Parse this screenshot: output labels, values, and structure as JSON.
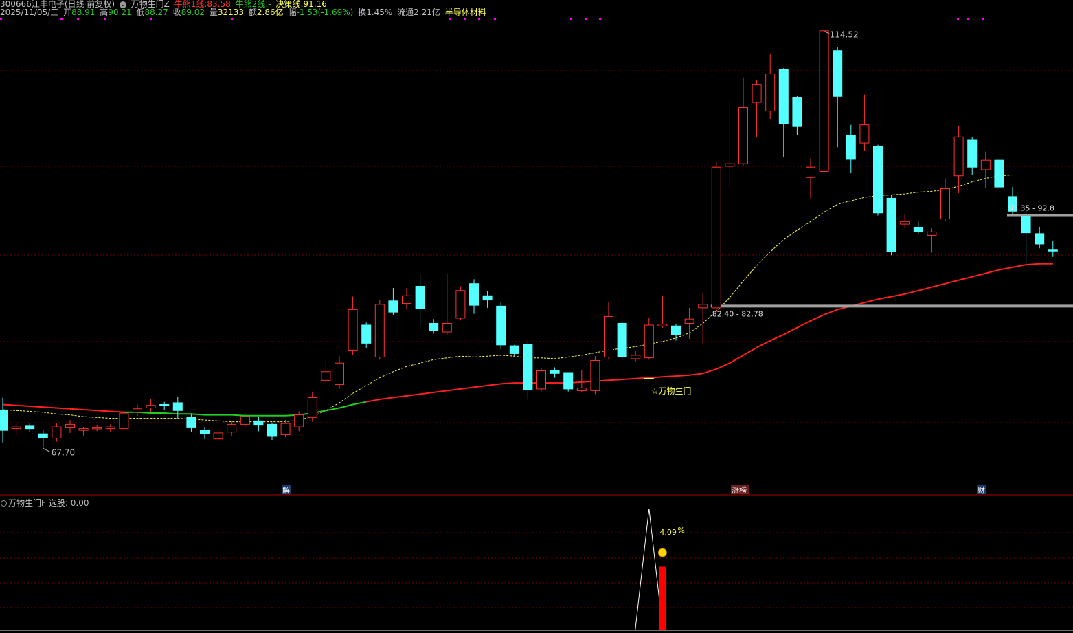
{
  "header": {
    "line1": {
      "code": "300666",
      "name": "江丰电子",
      "mode": "(日线 前复权)",
      "indicator_icon": "chevron-circle-icon",
      "indicator": "万物生门Z",
      "l1_label": "牛熊1线:",
      "l1_value": "83.58",
      "l2_label": "牛熊2线:",
      "l2_value": "-",
      "decision_label": "决策线:",
      "decision_value": "91.16"
    },
    "line2": {
      "date": "2025/11/05/三",
      "open_label": "开",
      "open": "88.91",
      "high_label": "高",
      "high": "90.21",
      "low_label": "低",
      "low": "88.27",
      "close_label": "收",
      "close": "89.02",
      "vol_label": "量",
      "vol": "32133",
      "amount_label": "额",
      "amount": "2.86亿",
      "chg_label": "幅",
      "chg": "-1.53(-1.69%)",
      "turnover": "换1.45%",
      "float_shares": "流通2.21亿",
      "sector": "半导体材料"
    }
  },
  "annotations": {
    "high_label": "114.52",
    "low_label": "67.70",
    "signal_label": "☆万物生门",
    "band_upper": "93.35 - 92.8",
    "band_lower": "82.40 - 82.78",
    "event_jie": "解",
    "event_zhangbang": "涨榜",
    "event_cai": "财"
  },
  "indicator": {
    "title": "万物生门F",
    "stat": "选股: 0.00",
    "peak_label": "4.09",
    "pct_mark": "%",
    "smile_icon": "smiley-face-icon"
  },
  "colors": {
    "up": "#ff3232",
    "down": "#54ffff",
    "ma_slow": "#ff2020",
    "ma_slow_bull": "#22cc22",
    "ma_fast": "#ffff55",
    "band": "#a0a0a0",
    "grid": "#7a0000",
    "magenta": "#ff00ff"
  },
  "chart_data": {
    "type": "candlestick",
    "price_range": [
      62.0,
      116.0
    ],
    "indicator_range": [
      0,
      100
    ],
    "candles": [
      [
        70.5,
        68.2,
        72.0,
        66.8
      ],
      [
        68.4,
        68.6,
        69.1,
        67.6
      ],
      [
        68.7,
        68.4,
        69.0,
        68.0
      ],
      [
        67.8,
        67.3,
        68.2,
        66.2
      ],
      [
        67.3,
        68.6,
        69.0,
        66.9
      ],
      [
        68.5,
        68.9,
        69.4,
        67.9
      ],
      [
        68.2,
        68.4,
        68.6,
        67.6
      ],
      [
        68.4,
        68.5,
        68.8,
        68.1
      ],
      [
        68.4,
        68.6,
        68.9,
        68.0
      ],
      [
        68.4,
        70.2,
        70.6,
        68.2
      ],
      [
        70.3,
        70.7,
        71.2,
        69.9
      ],
      [
        70.8,
        71.1,
        71.8,
        70.3
      ],
      [
        71.2,
        71.1,
        71.5,
        70.6
      ],
      [
        71.4,
        70.5,
        72.1,
        69.6
      ],
      [
        69.7,
        68.5,
        70.1,
        68.0
      ],
      [
        68.2,
        67.8,
        68.6,
        67.2
      ],
      [
        67.2,
        67.9,
        68.3,
        66.9
      ],
      [
        68.0,
        68.9,
        69.3,
        67.6
      ],
      [
        68.9,
        69.8,
        70.2,
        68.5
      ],
      [
        69.3,
        68.8,
        69.8,
        68.1
      ],
      [
        68.9,
        67.5,
        69.0,
        67.1
      ],
      [
        67.7,
        69.0,
        69.4,
        67.4
      ],
      [
        68.6,
        70.0,
        70.4,
        68.1
      ],
      [
        69.7,
        72.0,
        72.6,
        69.2
      ],
      [
        74.0,
        75.0,
        76.3,
        73.5
      ],
      [
        73.5,
        76.0,
        76.8,
        73.0
      ],
      [
        77.5,
        82.2,
        83.7,
        76.9
      ],
      [
        80.4,
        78.3,
        80.7,
        77.7
      ],
      [
        76.7,
        82.8,
        83.3,
        76.4
      ],
      [
        83.2,
        81.9,
        84.7,
        81.6
      ],
      [
        82.9,
        83.8,
        84.7,
        82.2
      ],
      [
        84.9,
        82.3,
        86.3,
        80.2
      ],
      [
        80.6,
        79.8,
        81.1,
        79.4
      ],
      [
        79.6,
        80.6,
        86.3,
        79.3
      ],
      [
        81.2,
        84.4,
        84.9,
        81.0
      ],
      [
        85.2,
        82.7,
        85.7,
        81.7
      ],
      [
        83.8,
        83.3,
        84.3,
        82.4
      ],
      [
        82.6,
        78.1,
        83.1,
        77.6
      ],
      [
        78.0,
        77.1,
        78.1,
        76.8
      ],
      [
        78.2,
        72.9,
        78.6,
        71.8
      ],
      [
        73.0,
        75.1,
        75.4,
        72.7
      ],
      [
        75.1,
        74.8,
        75.5,
        74.3
      ],
      [
        74.9,
        73.0,
        74.9,
        72.7
      ],
      [
        72.8,
        73.1,
        75.2,
        72.6
      ],
      [
        72.8,
        76.3,
        76.8,
        72.4
      ],
      [
        76.7,
        81.4,
        83.1,
        76.4
      ],
      [
        80.6,
        76.7,
        80.9,
        76.3
      ],
      [
        76.5,
        76.9,
        77.4,
        76.2
      ],
      [
        76.6,
        80.4,
        81.2,
        76.4
      ],
      [
        80.3,
        80.5,
        83.8,
        80.1
      ],
      [
        80.3,
        79.3,
        80.5,
        78.6
      ],
      [
        80.6,
        81.1,
        82.4,
        78.8
      ],
      [
        82.4,
        82.8,
        84.1,
        78.2
      ],
      [
        82.4,
        98.7,
        99.4,
        81.9
      ],
      [
        98.8,
        99.1,
        106.3,
        96.2
      ],
      [
        99.1,
        105.6,
        109.1,
        98.9
      ],
      [
        106.2,
        108.3,
        108.8,
        102.2
      ],
      [
        105.2,
        109.5,
        111.8,
        104.3
      ],
      [
        110.0,
        103.7,
        110.2,
        99.9
      ],
      [
        106.8,
        103.4,
        107.0,
        102.4
      ],
      [
        97.5,
        98.7,
        99.7,
        95.1
      ],
      [
        98.2,
        114.5,
        114.5,
        98.1
      ],
      [
        112.2,
        106.9,
        112.6,
        101.0
      ],
      [
        102.4,
        99.6,
        103.6,
        98.0
      ],
      [
        101.5,
        103.6,
        107.1,
        100.6
      ],
      [
        101.1,
        93.4,
        101.3,
        93.1
      ],
      [
        95.1,
        88.9,
        95.5,
        88.5
      ],
      [
        92.1,
        92.4,
        93.3,
        91.6
      ],
      [
        91.7,
        91.2,
        92.4,
        90.9
      ],
      [
        90.8,
        91.2,
        91.6,
        88.8
      ],
      [
        92.7,
        96.2,
        97.4,
        92.4
      ],
      [
        97.7,
        102.2,
        103.5,
        95.7
      ],
      [
        101.9,
        98.7,
        102.2,
        97.8
      ],
      [
        98.4,
        99.5,
        100.5,
        96.3
      ],
      [
        99.5,
        96.4,
        99.6,
        96.0
      ],
      [
        95.3,
        93.6,
        96.4,
        93.2
      ],
      [
        93.0,
        91.1,
        93.7,
        87.5
      ],
      [
        91.0,
        89.8,
        91.8,
        89.3
      ],
      [
        89.1,
        89.0,
        90.2,
        88.3
      ]
    ],
    "ma_fast": [
      70.6,
      70.5,
      70.4,
      70.3,
      70.1,
      70.0,
      69.8,
      69.7,
      69.6,
      69.6,
      69.6,
      69.6,
      69.6,
      69.6,
      69.5,
      69.4,
      69.3,
      69.2,
      69.2,
      69.2,
      69.2,
      69.2,
      69.4,
      69.8,
      70.5,
      71.4,
      72.5,
      73.4,
      74.3,
      75.0,
      75.6,
      76.0,
      76.4,
      76.6,
      76.8,
      76.7,
      76.8,
      76.9,
      76.8,
      76.6,
      76.6,
      76.5,
      76.7,
      76.9,
      77.2,
      77.5,
      77.7,
      77.9,
      78.2,
      78.5,
      78.9,
      79.5,
      80.6,
      82.0,
      83.6,
      85.5,
      87.3,
      88.9,
      90.3,
      91.4,
      92.4,
      93.5,
      94.4,
      94.8,
      95.2,
      95.4,
      95.5,
      95.6,
      95.8,
      95.9,
      96.1,
      96.5,
      97.0,
      97.4,
      97.7,
      97.8,
      97.8,
      97.8,
      97.8
    ],
    "ma_slow": [
      71.2,
      71.1,
      71.0,
      70.9,
      70.8,
      70.7,
      70.6,
      70.5,
      70.4,
      70.3,
      70.3,
      70.2,
      70.2,
      70.1,
      70.1,
      70.0,
      70.0,
      70.0,
      69.9,
      69.9,
      69.9,
      69.9,
      70.0,
      70.2,
      70.5,
      70.8,
      71.2,
      71.5,
      71.8,
      72.0,
      72.2,
      72.4,
      72.6,
      72.8,
      73.0,
      73.2,
      73.4,
      73.6,
      73.7,
      73.7,
      73.7,
      73.7,
      73.7,
      73.8,
      73.9,
      74.0,
      74.1,
      74.2,
      74.3,
      74.4,
      74.5,
      74.6,
      74.8,
      75.3,
      76.0,
      76.9,
      77.8,
      78.6,
      79.3,
      80.1,
      80.9,
      81.6,
      82.2,
      82.6,
      83.0,
      83.4,
      83.7,
      84.0,
      84.4,
      84.8,
      85.2,
      85.6,
      86.0,
      86.4,
      86.8,
      87.1,
      87.4,
      87.5,
      87.5
    ],
    "ma_slow_bull_range": [
      9,
      27
    ],
    "levels": [
      {
        "label": "93.35 - 92.8",
        "value": 93.1,
        "from_index": 75
      },
      {
        "label": "82.40 - 82.78",
        "value": 82.6,
        "from_index": 53
      }
    ],
    "markers": {
      "max_index": 61,
      "max_value": 114.52,
      "min_index": 3,
      "min_value": 67.7,
      "signal_index": 48
    },
    "indicator_peak_index": 48,
    "indicator_peak_value": 100,
    "indicator_bar_index": 49,
    "indicator_bar_value": 52
  }
}
